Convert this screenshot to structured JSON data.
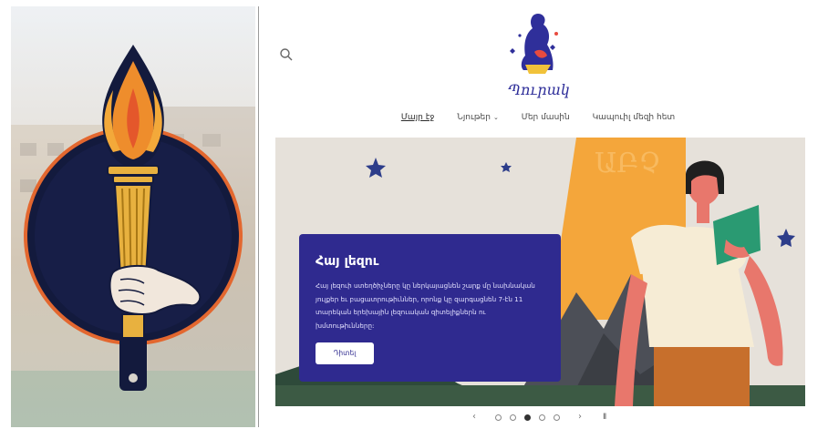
{
  "brand": {
    "logo_text": "Պուրակ",
    "accent_color": "#2f2a8f",
    "search_icon": "search-icon"
  },
  "nav": {
    "items": [
      {
        "label": "Մայր էջ",
        "active": true
      },
      {
        "label": "Նյութեր",
        "has_dropdown": true
      },
      {
        "label": "Մեր մասին"
      },
      {
        "label": "Կապուիլ մեզի հետ"
      }
    ]
  },
  "hero": {
    "title": "Հայ լեզու",
    "text": "Հայ լեզուի ստեղծիչները կը ներկայացնեն շարք մը նախնական յուլքեր եւ բացատրութիւններ, որոնք կը զարգացնեն 7-էն 11 տարեկան երեխային լեզուական զիտելիքներն ու խմտութիւնները:",
    "button_label": "Դիտել",
    "bg_letters": "ԱԲՉ"
  },
  "carousel": {
    "prev_label": "‹",
    "next_label": "›",
    "pause_label": "II",
    "slides": 5,
    "active_index": 2
  }
}
